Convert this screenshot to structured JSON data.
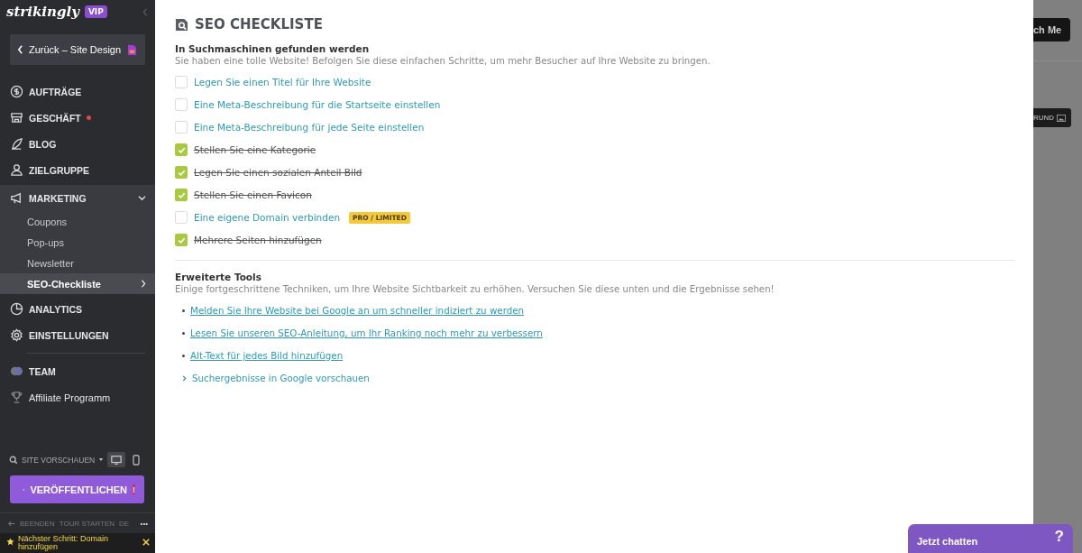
{
  "sidebar": {
    "logo": "strikingly",
    "badge": "VIP",
    "back_button": "Zurück – Site Design",
    "nav": [
      {
        "label": "AUFTRÄGE",
        "notification": false,
        "expanded": false
      },
      {
        "label": "GESCHÄFT",
        "notification": true,
        "expanded": false
      },
      {
        "label": "BLOG",
        "notification": false,
        "expanded": false
      },
      {
        "label": "ZIELGRUPPE",
        "notification": false,
        "expanded": false
      },
      {
        "label": "MARKETING",
        "notification": false,
        "expanded": true,
        "children": [
          {
            "label": "Coupons",
            "selected": false
          },
          {
            "label": "Pop-ups",
            "selected": false
          },
          {
            "label": "Newsletter",
            "selected": false
          },
          {
            "label": "SEO-Checkliste",
            "selected": true
          }
        ]
      },
      {
        "label": "ANALYTICS",
        "notification": false,
        "expanded": false
      },
      {
        "label": "EINSTELLUNGEN",
        "notification": false,
        "expanded": false
      }
    ],
    "extra": [
      {
        "label": "TEAM"
      },
      {
        "label": "Affiliate Programm"
      }
    ],
    "preview": "SITE VORSCHAUEN",
    "devices": [
      {
        "kind": "desktop",
        "selected": true
      },
      {
        "kind": "mobile",
        "selected": false
      }
    ],
    "publish": "VERÖFFENTLICHEN",
    "publish_alert": "!",
    "footer_links": [
      "BEENDEN",
      "TOUR STARTEN",
      "DE",
      "•••"
    ],
    "next_step": "Nächster Schritt: Domain hinzufügen"
  },
  "panel": {
    "title": "SEO CHECKLISTE",
    "section1": {
      "heading": "In Suchmaschinen gefunden werden",
      "text": "Sie haben eine tolle Website! Befolgen Sie diese einfachen Schritte, um mehr Besucher auf Ihre Website zu bringen.",
      "items": [
        {
          "label": "Legen Sie einen Titel für Ihre Website",
          "checked": false
        },
        {
          "label": "Eine Meta-Beschreibung für die Startseite einstellen",
          "checked": false
        },
        {
          "label": "Eine Meta-Beschreibung für jede Seite einstellen",
          "checked": false
        },
        {
          "label": "Stellen Sie eine Kategorie",
          "checked": true
        },
        {
          "label": "Legen Sie einen sozialen Anteil Bild",
          "checked": true
        },
        {
          "label": "Stellen Sie einen Favicon",
          "checked": true
        },
        {
          "label": "Eine eigene Domain verbinden",
          "checked": false,
          "tag": "PRO / LIMITED"
        },
        {
          "label": "Mehrere Seiten hinzufügen",
          "checked": true
        }
      ]
    },
    "section2": {
      "heading": "Erweiterte Tools",
      "text": "Einige fortgeschrittene Techniken, um Ihre Website Sichtbarkeit zu erhöhen. Versuchen Sie diese unten und die Ergebnisse sehen!",
      "links": [
        {
          "label": "Melden Sie Ihre Website bei Google an um schneller indiziert zu werden",
          "kind": "bullet"
        },
        {
          "label": "Lesen Sie unseren SEO-Anleitung, um Ihr Ranking noch mehr zu verbessern",
          "kind": "bullet"
        },
        {
          "label": "Alt-Text für jedes Bild hinzufügen",
          "kind": "bullet"
        },
        {
          "label": "Suchergebnisse in Google vorschauen",
          "kind": "expander"
        }
      ]
    }
  },
  "background": {
    "button_1": "ch Me",
    "button_2": "RUND"
  },
  "chat": {
    "label": "Jetzt chatten",
    "help": "?"
  }
}
